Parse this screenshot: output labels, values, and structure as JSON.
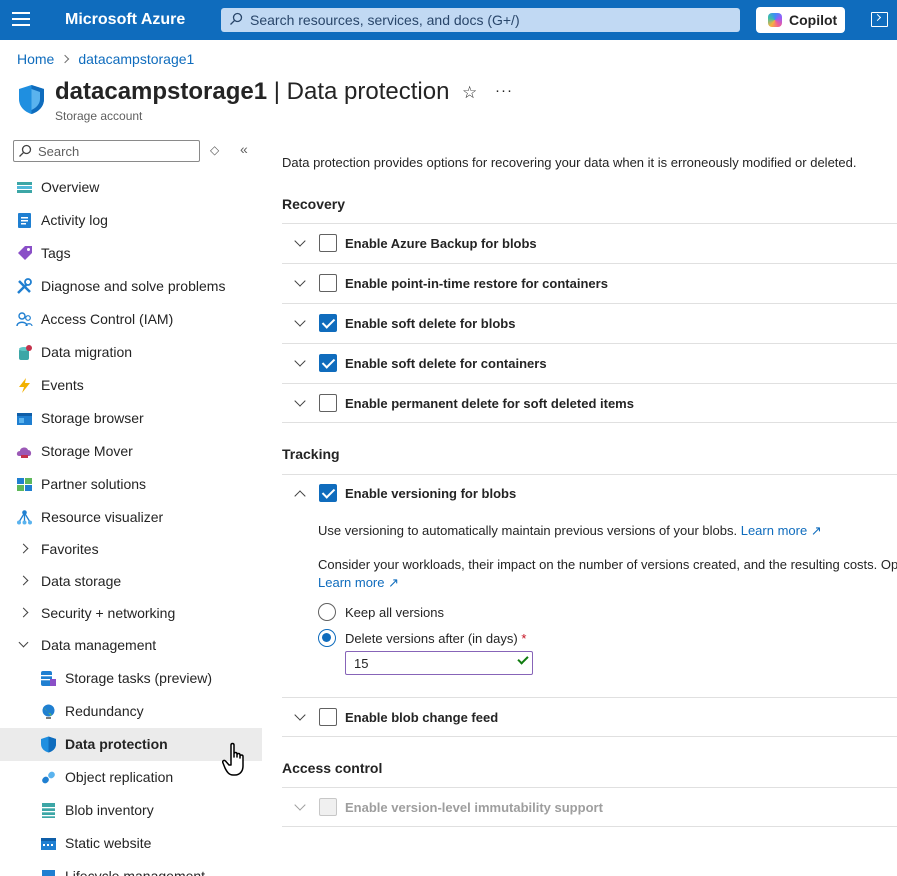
{
  "topbar": {
    "brand": "Microsoft Azure",
    "search_placeholder": "Search resources, services, and docs (G+/)",
    "copilot_label": "Copilot",
    "accent": "#0f6cbd"
  },
  "breadcrumb": {
    "home": "Home",
    "resource": "datacampstorage1"
  },
  "header": {
    "resource_name": "datacampstorage1",
    "separator": " | ",
    "section": "Data protection",
    "subtitle": "Storage account",
    "star_glyph": "☆",
    "more_glyph": "···"
  },
  "sidebar": {
    "search_placeholder": "Search",
    "ctl_glyph": "◇",
    "collapse_glyph": "«",
    "items": [
      {
        "label": "Overview",
        "icon": "overview-icon"
      },
      {
        "label": "Activity log",
        "icon": "activity-log-icon"
      },
      {
        "label": "Tags",
        "icon": "tag-icon"
      },
      {
        "label": "Diagnose and solve problems",
        "icon": "wrench-icon"
      },
      {
        "label": "Access Control (IAM)",
        "icon": "people-icon"
      },
      {
        "label": "Data migration",
        "icon": "migration-icon"
      },
      {
        "label": "Events",
        "icon": "lightning-icon"
      },
      {
        "label": "Storage browser",
        "icon": "storage-browser-icon"
      },
      {
        "label": "Storage Mover",
        "icon": "cloud-mover-icon"
      },
      {
        "label": "Partner solutions",
        "icon": "partner-icon"
      },
      {
        "label": "Resource visualizer",
        "icon": "visualizer-icon"
      },
      {
        "label": "Favorites",
        "icon": "chevron-right-icon"
      },
      {
        "label": "Data storage",
        "icon": "chevron-right-icon"
      },
      {
        "label": "Security + networking",
        "icon": "chevron-right-icon"
      },
      {
        "label": "Data management",
        "icon": "chevron-down-icon"
      },
      {
        "label": "Storage tasks (preview)",
        "icon": "storage-tasks-icon"
      },
      {
        "label": "Redundancy",
        "icon": "globe-icon"
      },
      {
        "label": "Data protection",
        "icon": "shield-icon"
      },
      {
        "label": "Object replication",
        "icon": "replication-icon"
      },
      {
        "label": "Blob inventory",
        "icon": "inventory-icon"
      },
      {
        "label": "Static website",
        "icon": "website-icon"
      },
      {
        "label": "Lifecycle management",
        "icon": "lifecycle-icon"
      }
    ]
  },
  "main": {
    "intro": "Data protection provides options for recovering your data when it is erroneously modified or deleted.",
    "recovery": {
      "title": "Recovery",
      "options": [
        {
          "label": "Enable Azure Backup for blobs",
          "checked": false
        },
        {
          "label": "Enable point-in-time restore for containers",
          "checked": false
        },
        {
          "label": "Enable soft delete for blobs",
          "checked": true
        },
        {
          "label": "Enable soft delete for containers",
          "checked": true
        },
        {
          "label": "Enable permanent delete for soft deleted items",
          "checked": false
        }
      ]
    },
    "tracking": {
      "title": "Tracking",
      "versioning": {
        "label": "Enable versioning for blobs",
        "checked": true,
        "desc": "Use versioning to automatically maintain previous versions of your blobs.",
        "learn_more": "Learn more",
        "desc2": "Consider your workloads, their impact on the number of versions created, and the resulting costs. Opt",
        "learn_more2": "Learn more",
        "radio_keep": "Keep all versions",
        "radio_delete": "Delete versions after (in days)",
        "required": "*",
        "days_value": "15"
      },
      "change_feed": {
        "label": "Enable blob change feed",
        "checked": false
      }
    },
    "access_control": {
      "title": "Access control",
      "immutability": {
        "label": "Enable version-level immutability support",
        "checked": false,
        "disabled": true
      }
    },
    "external_glyph": "↗"
  }
}
